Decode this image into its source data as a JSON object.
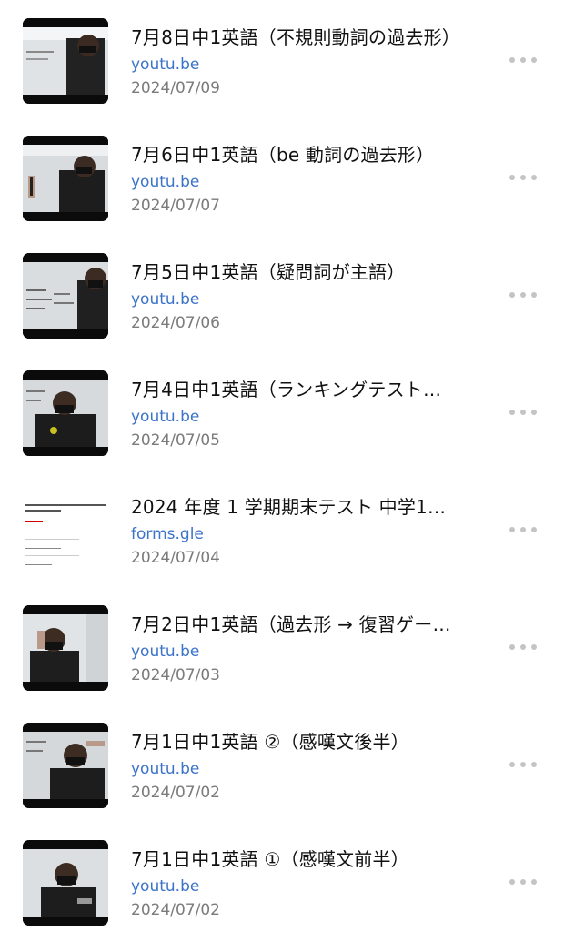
{
  "items": [
    {
      "title": "7月8日中1英語（不規則動詞の過去形）",
      "domain": "youtu.be",
      "date": "2024/07/09",
      "thumb": "video"
    },
    {
      "title": "7月6日中1英語（be 動詞の過去形）",
      "domain": "youtu.be",
      "date": "2024/07/07",
      "thumb": "video"
    },
    {
      "title": "7月5日中1英語（疑問詞が主語）",
      "domain": "youtu.be",
      "date": "2024/07/06",
      "thumb": "video"
    },
    {
      "title": "7月4日中1英語（ランキングテスト…",
      "domain": "youtu.be",
      "date": "2024/07/05",
      "thumb": "video"
    },
    {
      "title": "2024 年度 1 学期期末テスト 中学1…",
      "domain": "forms.gle",
      "date": "2024/07/04",
      "thumb": "form"
    },
    {
      "title": "7月2日中1英語（過去形 → 復習ゲー…",
      "domain": "youtu.be",
      "date": "2024/07/03",
      "thumb": "video"
    },
    {
      "title": "7月1日中1英語 ②（感嘆文後半）",
      "domain": "youtu.be",
      "date": "2024/07/02",
      "thumb": "video"
    },
    {
      "title": "7月1日中1英語 ①（感嘆文前半）",
      "domain": "youtu.be",
      "date": "2024/07/02",
      "thumb": "video"
    }
  ],
  "icons": {
    "more": "more-options-icon"
  },
  "colors": {
    "link": "#3b73c9",
    "date": "#7b7b7b",
    "title": "#111111"
  }
}
